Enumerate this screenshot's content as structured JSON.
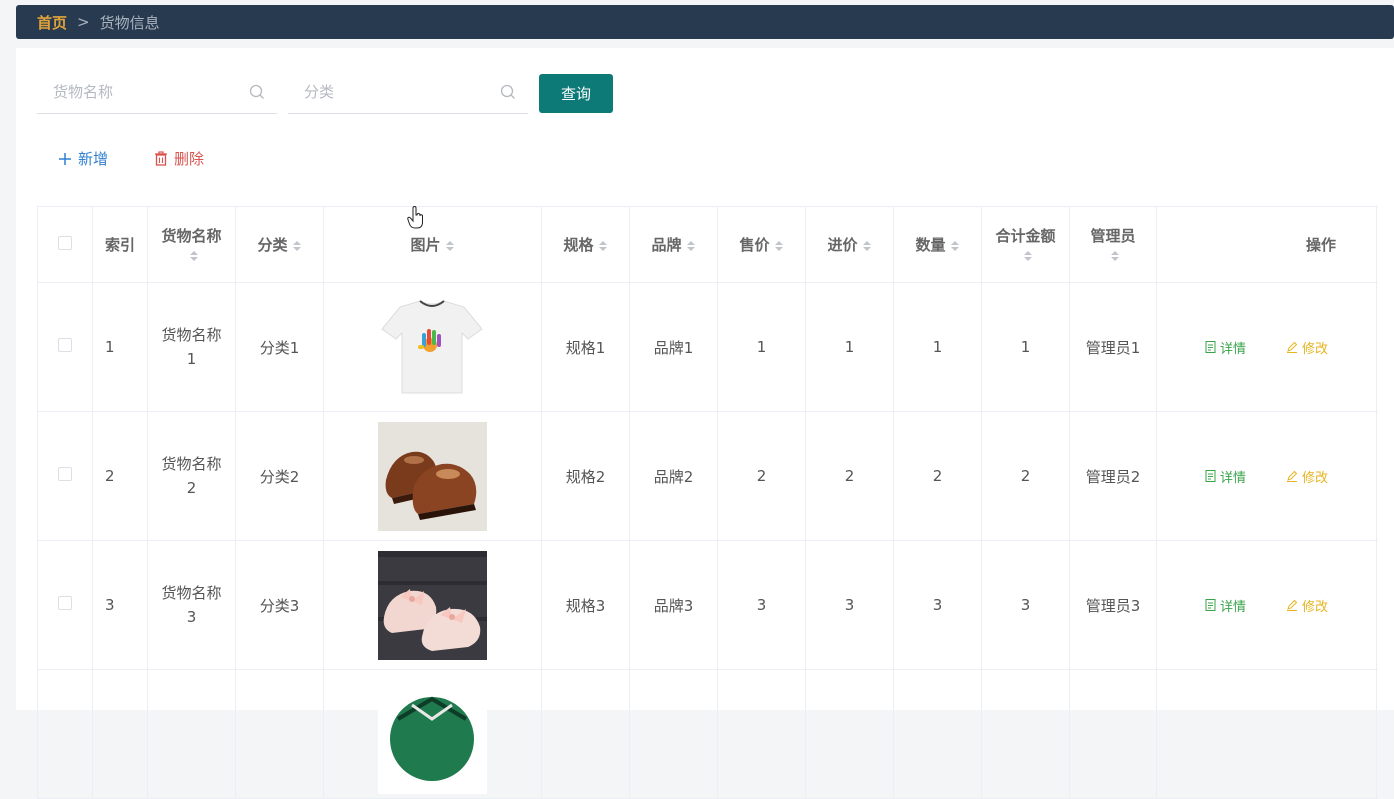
{
  "breadcrumb": {
    "home": "首页",
    "separator": ">",
    "current": "货物信息"
  },
  "search": {
    "name_placeholder": "货物名称",
    "category_placeholder": "分类",
    "query_label": "查询"
  },
  "actions": {
    "add_label": "新增",
    "delete_label": "删除"
  },
  "table": {
    "headers": {
      "index": "索引",
      "name": "货物名称",
      "category": "分类",
      "image": "图片",
      "spec": "规格",
      "brand": "品牌",
      "sale_price": "售价",
      "cost_price": "进价",
      "quantity": "数量",
      "total": "合计金额",
      "admin": "管理员",
      "operation": "操作"
    },
    "rows": [
      {
        "index": "1",
        "name": "货物名称1",
        "category": "分类1",
        "image": "white-tshirt",
        "spec": "规格1",
        "brand": "品牌1",
        "sale_price": "1",
        "cost_price": "1",
        "quantity": "1",
        "total": "1",
        "admin": "管理员1",
        "detail": "详情",
        "edit": "修改"
      },
      {
        "index": "2",
        "name": "货物名称2",
        "category": "分类2",
        "image": "brown-leather-shoes",
        "spec": "规格2",
        "brand": "品牌2",
        "sale_price": "2",
        "cost_price": "2",
        "quantity": "2",
        "total": "2",
        "admin": "管理员2",
        "detail": "详情",
        "edit": "修改"
      },
      {
        "index": "3",
        "name": "货物名称3",
        "category": "分类3",
        "image": "pink-bow-shoes",
        "spec": "规格3",
        "brand": "品牌3",
        "sale_price": "3",
        "cost_price": "3",
        "quantity": "3",
        "total": "3",
        "admin": "管理员3",
        "detail": "详情",
        "edit": "修改"
      }
    ]
  },
  "colors": {
    "topbar": "#283a4f",
    "home": "#e0a33a",
    "primary": "#0e7a78",
    "add": "#2f7fd1",
    "delete": "#d9534f",
    "detail": "#3aa34a",
    "edit": "#e6b422"
  }
}
